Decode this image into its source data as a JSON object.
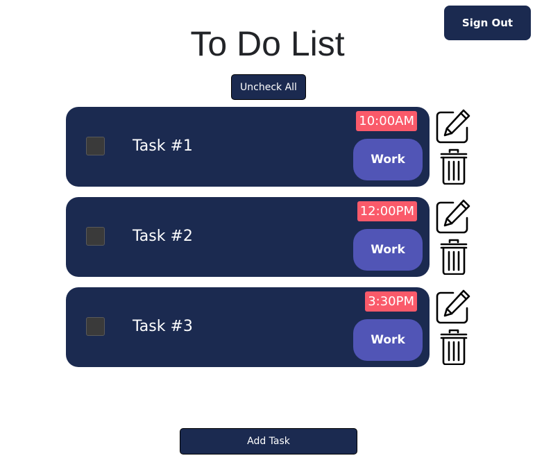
{
  "header": {
    "sign_out_label": "Sign Out",
    "title": "To Do List"
  },
  "toolbar": {
    "uncheck_all_label": "Uncheck All"
  },
  "tasks": [
    {
      "name": "Task #1",
      "time": "10:00AM",
      "category": "Work",
      "checked": false
    },
    {
      "name": "Task #2",
      "time": "12:00PM",
      "category": "Work",
      "checked": false
    },
    {
      "name": "Task #3",
      "time": "3:30PM",
      "category": "Work",
      "checked": false
    }
  ],
  "footer": {
    "add_task_label": "Add Task"
  },
  "icons": {
    "edit": "edit-icon",
    "delete": "trash-icon"
  },
  "colors": {
    "primary": "#1b2a50",
    "time_badge": "#fa5a6a",
    "category_tag": "#5155b6",
    "checkbox": "#3a3a3a",
    "title_text": "#222428"
  }
}
